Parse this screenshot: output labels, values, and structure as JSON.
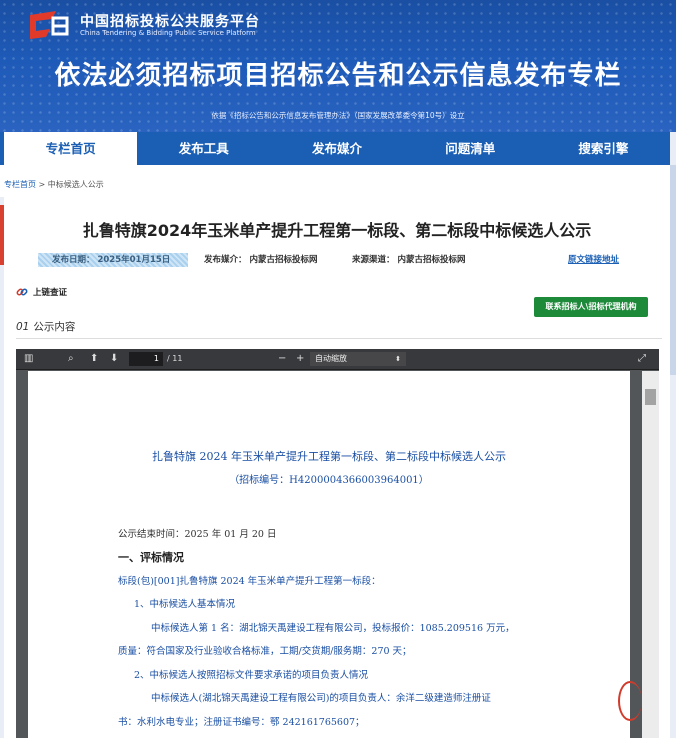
{
  "header": {
    "logo_cn": "中国招标投标公共服务平台",
    "logo_en": "China Tendering & Bidding Public Service Platform",
    "title": "依法必须招标项目招标公告和公示信息发布专栏",
    "subtitle": "依据《招标公告和公示信息发布管理办法》（国家发展改革委令第10号）设立"
  },
  "nav": {
    "items": [
      "专栏首页",
      "发布工具",
      "发布媒介",
      "问题清单",
      "搜索引擎"
    ]
  },
  "breadcrumb": {
    "home": "专栏首页",
    "sep": " > ",
    "current": "中标候选人公示"
  },
  "article": {
    "title": "扎鲁特旗2024年玉米单产提升工程第一标段、第二标段中标候选人公示",
    "publish_date": "发布日期：  2025年01月15日",
    "media": "发布媒介：  内蒙古招标投标网",
    "source": "来源渠道：  内蒙古招标投标网",
    "original_link": "原文链接地址",
    "chain_check": "上链查证",
    "contact_button": "联系招标人\\招标代理机构",
    "section_num": "01",
    "section_title": "公示内容"
  },
  "pdf": {
    "page_current": "1",
    "page_total": "/ 11",
    "zoom": "自动缩放",
    "title": "扎鲁特旗 2024 年玉米单产提升工程第一标段、第二标段中标候选人公示",
    "code": "（招标编号：H4200004366003964001）",
    "lines": [
      "公示结束时间：2025 年 01 月 20 日",
      "一、评标情况",
      "标段(包)[001]扎鲁特旗 2024 年玉米单产提升工程第一标段：",
      "1、中标候选人基本情况",
      "中标候选人第 1 名：湖北锦天禹建设工程有限公司，投标报价：1085.209516 万元，",
      "质量：符合国家及行业验收合格标准，工期/交货期/服务期：270 天；",
      "2、中标候选人按照招标文件要求承诺的项目负责人情况",
      "中标候选人(湖北锦天禹建设工程有限公司)的项目负责人：余洋二级建造师注册证",
      "书：水利水电专业；注册证书编号：鄂 242161765607；"
    ]
  },
  "colors": {
    "brand_blue": "#1a5fb4",
    "button_green": "#1d8a3a",
    "logo_red": "#d8402f"
  }
}
